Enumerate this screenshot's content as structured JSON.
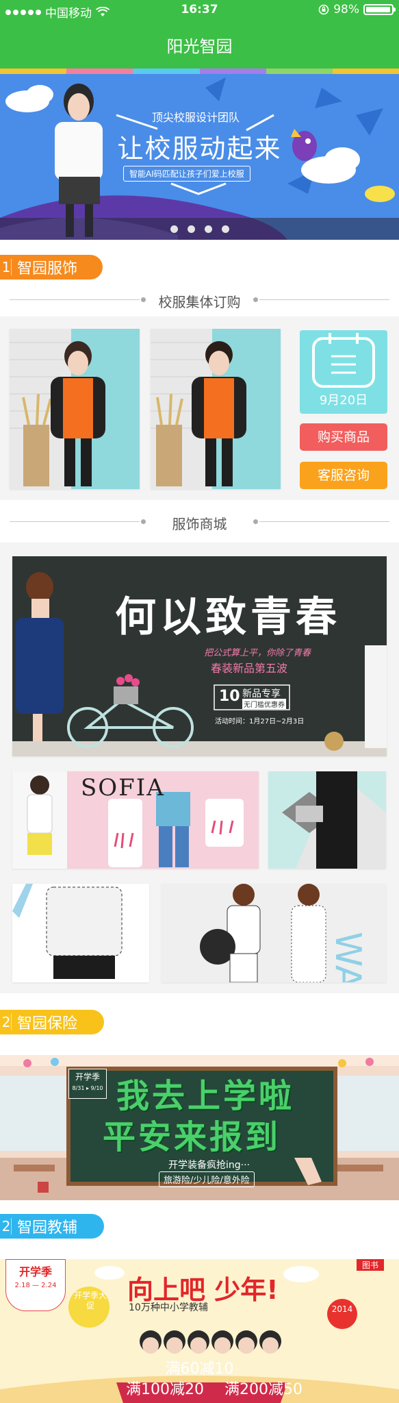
{
  "status_bar": {
    "carrier": "中国移动",
    "time": "16:37",
    "battery": "98%",
    "battery_level": 0.98
  },
  "nav": {
    "title": "阳光智园"
  },
  "banner": {
    "headline": "让校服动起来",
    "subhead": "顶尖校服设计团队",
    "tagline": "智能AI码匹配让孩子们爱上校服",
    "page_count": 4,
    "active_page": 1
  },
  "sections": {
    "clothing": {
      "num": "1",
      "title": "智园服饰",
      "color": "#f78a1c"
    },
    "insurance": {
      "num": "2",
      "title": "智园保险",
      "color": "#f8c21a"
    },
    "tutoring": {
      "num": "2",
      "title": "智园教辅",
      "color": "#2fb5ee"
    }
  },
  "uniform_order": {
    "heading": "校服集体订购",
    "date": "9月20日",
    "buy_label": "购买商品",
    "service_label": "客服咨询"
  },
  "mall": {
    "heading": "服饰商城",
    "promo_title": "何以致青春",
    "promo_line": "把公式算上平，你除了青春",
    "promo_sub": "春装新品第五波",
    "coupon_value": "10",
    "coupon_line1": "新品专享",
    "coupon_line2": "无门槛优惠券",
    "promo_time": "活动时间：1月27日~2月3日",
    "brand": "SOFIA"
  },
  "insurance_banner": {
    "badge_title": "开学季",
    "badge_dates": "8/31 ▸ 9/10",
    "line1": "我去上学啦",
    "line2": "平安来报到",
    "line3": "开学装备疯抢ing···",
    "line4": "旅游险/少儿险/意外险"
  },
  "tutoring_banner": {
    "badge_title": "开学季",
    "badge_dates": "2.18 — 2.24",
    "corner": "图书",
    "seal": "开学季大促",
    "headline": "向上吧 少年!",
    "sub": "10万种中小学教辅",
    "year": "2014",
    "offer1": "满60减10",
    "offer2": "满100减20",
    "offer3": "满200减50"
  },
  "colors": {
    "primary_green": "#3cbf46",
    "buy_red": "#f25e5e",
    "service_orange": "#fba21c",
    "calendar_cyan": "#7ee0e4"
  }
}
